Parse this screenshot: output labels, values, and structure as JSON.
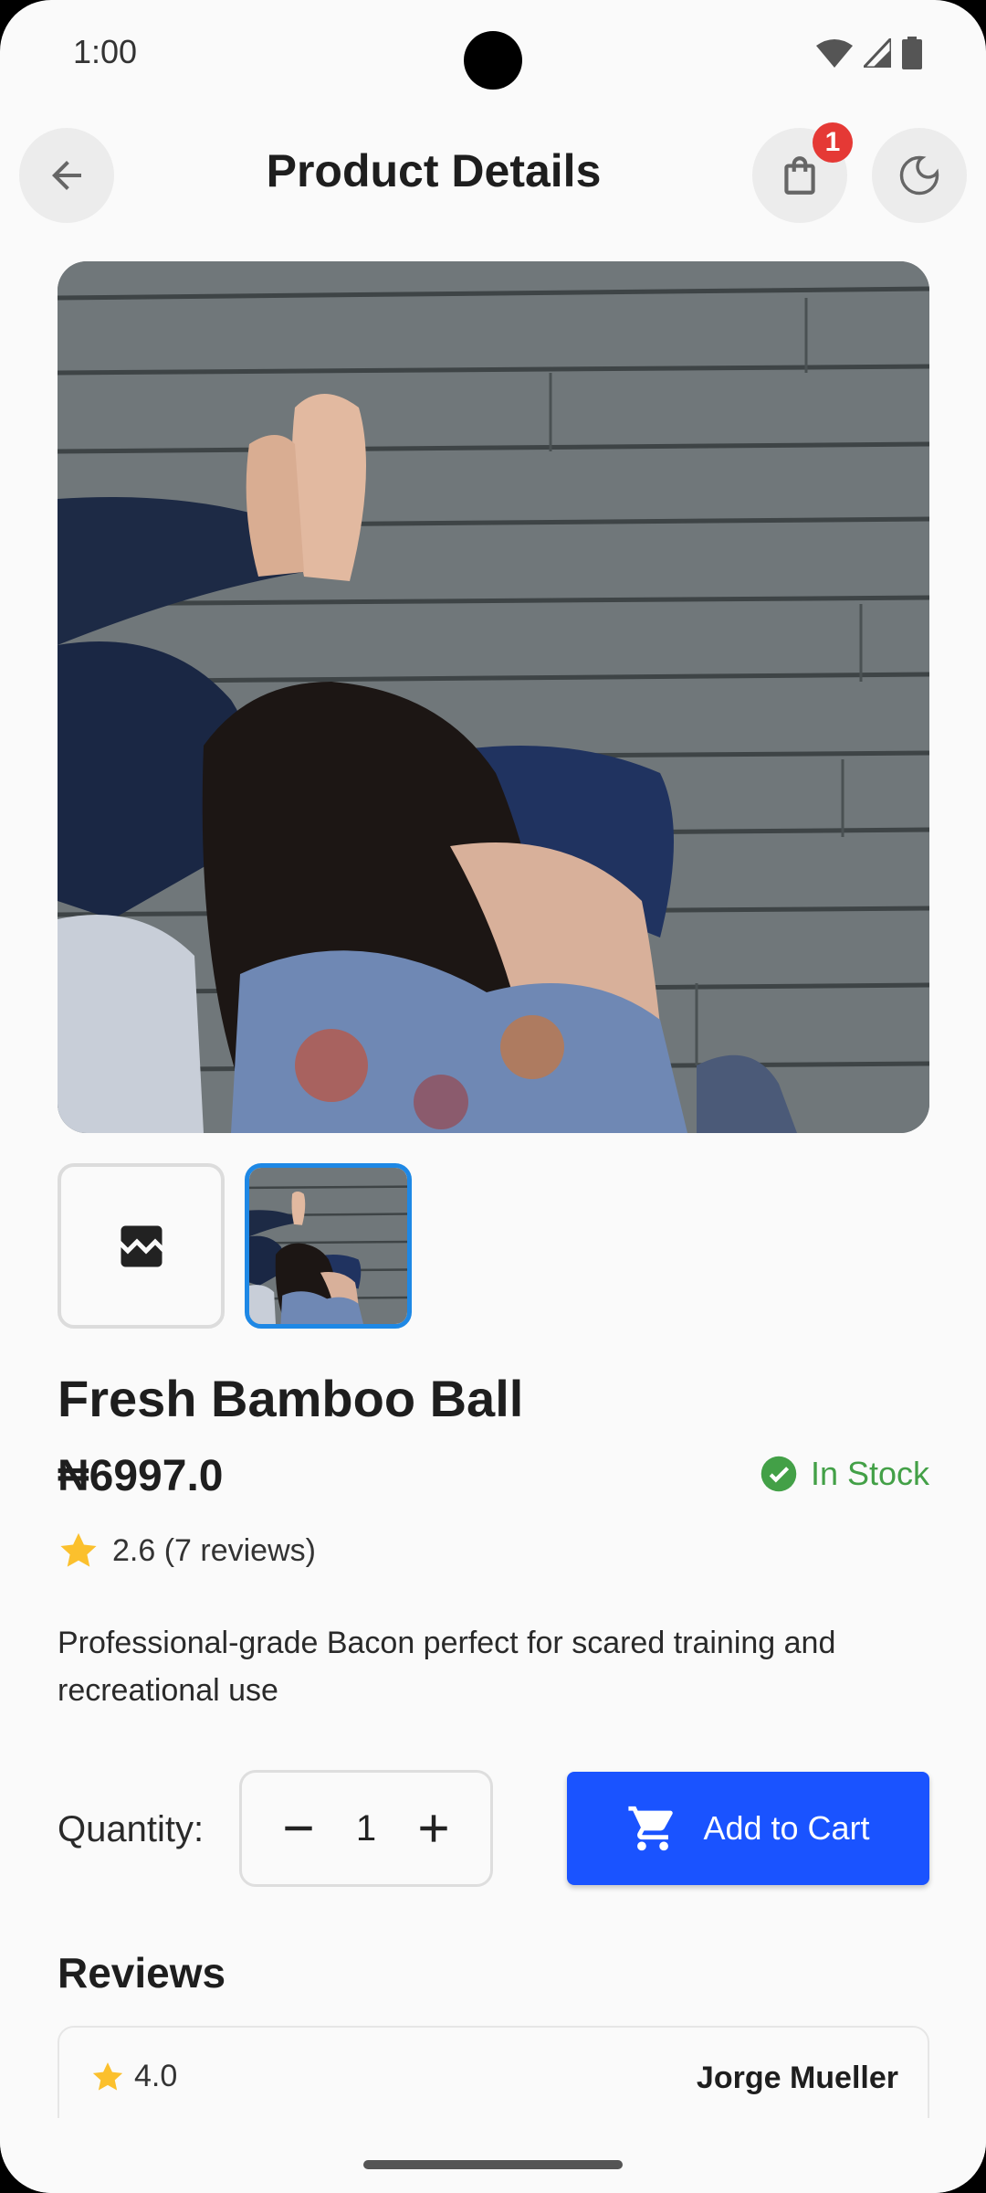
{
  "status_bar": {
    "time": "1:00"
  },
  "app_bar": {
    "title": "Product Details",
    "cart_badge": "1"
  },
  "product": {
    "name": "Fresh Bamboo Ball",
    "price": "₦6997.0",
    "stock_status": "In Stock",
    "rating_summary": "2.6 (7 reviews)",
    "description": "Professional-grade Bacon perfect for scared training and recreational use"
  },
  "purchase": {
    "quantity_label": "Quantity:",
    "quantity": "1",
    "add_to_cart_label": "Add to Cart"
  },
  "reviews": {
    "heading": "Reviews",
    "items": [
      {
        "rating": "4.0",
        "author": "Jorge Mueller"
      }
    ]
  },
  "colors": {
    "accent": "#1a53ff",
    "in_stock": "#43a047",
    "star": "#fbc02d",
    "badge": "#e53935",
    "selected_thumb_border": "#1e88e5"
  },
  "icons": [
    "back-arrow-icon",
    "shopping-bag-icon",
    "dark-mode-icon",
    "broken-image-icon",
    "check-circle-icon",
    "star-icon",
    "minus-icon",
    "plus-icon",
    "cart-icon",
    "wifi-icon",
    "signal-icon",
    "battery-icon"
  ]
}
